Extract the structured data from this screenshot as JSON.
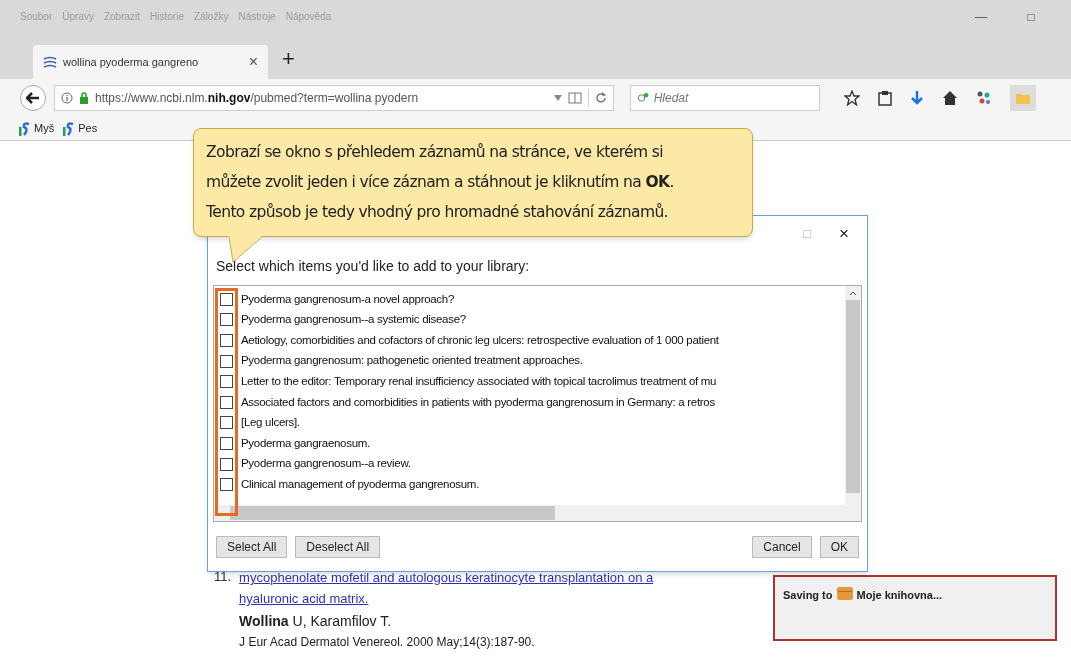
{
  "menu_bar": [
    "Soubor",
    "Úpravy",
    "Zobrazit",
    "Historie",
    "Záložky",
    "Nástroje",
    "Nápověda"
  ],
  "window_controls": [
    "—",
    "□"
  ],
  "tab": {
    "title": "wollina pyoderma gangreno",
    "close": "×",
    "new_tab": "+"
  },
  "address_bar": {
    "url_start": "https://www.ncbi.nlm.",
    "url_bold": "nih.gov",
    "url_end": "/pubmed?term=wollina pyodern"
  },
  "search": {
    "placeholder": "Hledat"
  },
  "bookmarks": [
    "Myš",
    "Pes"
  ],
  "tooltip": {
    "lines": [
      "Zobrazí se okno s přehledem záznamů na stránce, ve kterém si",
      "můžete zvolit jeden i více záznam a stáhnout je kliknutím na **OK**.",
      "Tento způsob je tedy vhodný pro hromadné stahování záznamů."
    ]
  },
  "dialog": {
    "controls": [
      "□",
      "×"
    ],
    "prompt": "Select which items you'd like to add to your library:",
    "items": [
      {
        "title": "Pyoderma gangrenosum-a novel approach?",
        "checked": false
      },
      {
        "title": "Pyoderma gangrenosum--a systemic disease?",
        "checked": false
      },
      {
        "title": "Aetiology, comorbidities and cofactors of chronic leg ulcers: retrospective evaluation of 1 000 patient",
        "checked": false
      },
      {
        "title": "Pyoderma gangrenosum: pathogenetic oriented treatment approaches.",
        "checked": false
      },
      {
        "title": "Letter to the editor: Temporary renal insufficiency associated with topical tacrolimus treatment of mu",
        "checked": false
      },
      {
        "title": "Associated factors and comorbidities in patients with pyoderma gangrenosum in Germany: a retros",
        "checked": false
      },
      {
        "title": "[Leg ulcers].",
        "checked": false
      },
      {
        "title": "Pyoderma gangraenosum.",
        "checked": false
      },
      {
        "title": "Pyoderma gangrenosum--a review.",
        "checked": false
      },
      {
        "title": "Clinical management of pyoderma gangrenosum.",
        "checked": false
      }
    ],
    "buttons_left": [
      "Select All",
      "Deselect All"
    ],
    "buttons_right": [
      "Cancel",
      "OK"
    ]
  },
  "result": {
    "number": "11.",
    "link_line1": "mycophenolate mofetil and autologous keratinocyte transplantation on a",
    "link_line2": "hyaluronic acid matrix.",
    "authors": "**Wollina** U, Karamfilov T.",
    "journal": "J Eur Acad Dermatol Venereol. 2000 May;14(3):187-90."
  },
  "saving": {
    "label": "Saving to",
    "library": "Moje knihovna..."
  }
}
